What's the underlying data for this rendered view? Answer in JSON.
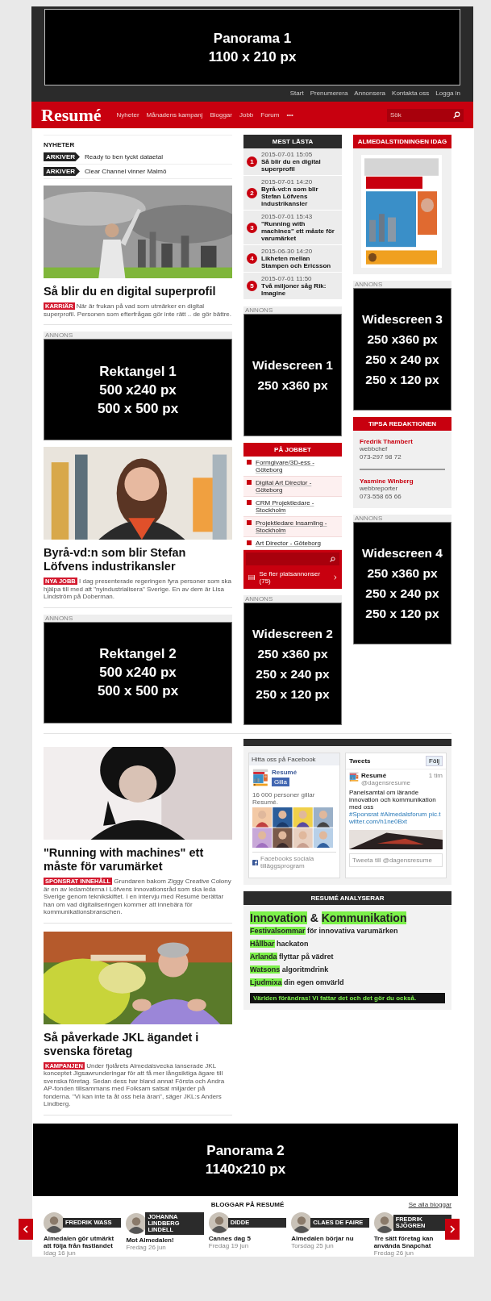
{
  "panorama_top": {
    "lines": [
      "Panorama 1",
      "1100 x 210 px"
    ]
  },
  "top_links": [
    "Start",
    "Prenumerera",
    "Annonsera",
    "Kontakta oss",
    "Logga in"
  ],
  "logo": "Resumé",
  "nav": [
    "Nyheter",
    "Månadens kampanj",
    "Bloggar",
    "Jobb",
    "Forum",
    "•••"
  ],
  "search": {
    "placeholder": "Sök"
  },
  "news_ticker": {
    "heading": "NYHETER",
    "items": [
      {
        "tag": "ARKIVER",
        "text": "Ready to ben tyckt dataetal"
      },
      {
        "tag": "ARKIVER",
        "text": "Clear Channel vinner Malmö"
      }
    ]
  },
  "feed": [
    {
      "kind": "article",
      "headline": "Så blir du en digital superprofil",
      "tag": "KARRIÄR",
      "text": "När är frukan på vad som utmärker en digital superprofil. Personen som efterfrågas gör inte rätt .. de gör bättre."
    },
    {
      "kind": "ad",
      "label": "ANNONS",
      "lines": [
        "Rektangel 1",
        "500 x240 px",
        "500 x 500 px"
      ]
    },
    {
      "kind": "article",
      "headline": "Byrå-vd:n som blir Stefan Löfvens industrikansler",
      "tag": "NYA JOBB",
      "text": "I dag presenterade regeringen fyra personer som ska hjälpa till med att \"nyindustrialisera\" Sverige. En av dem är Lisa Lindström på Doberman."
    },
    {
      "kind": "ad",
      "label": "ANNONS",
      "lines": [
        "Rektangel 2",
        "500 x240 px",
        "500 x 500 px"
      ]
    }
  ],
  "most_read": {
    "heading": "MEST LÄSTA",
    "items": [
      {
        "number": "1",
        "time": "2015-07-01 15:05",
        "title": "Så blir du en digital superprofil"
      },
      {
        "number": "2",
        "time": "2015-07-01 14:20",
        "title": "Byrå-vd:n som blir Stefan Löfvens industrikansler"
      },
      {
        "number": "3",
        "time": "2015-07-01 15:43",
        "title": "\"Running with machines\" ett måste för varumärket"
      },
      {
        "number": "4",
        "time": "2015-06-30 14:20",
        "title": "Likheten mellan Stampen och Ericsson"
      },
      {
        "number": "5",
        "time": "2015-07-01 11:50",
        "title": "Två miljoner såg Rik: Imagine"
      }
    ]
  },
  "widescreen_1": {
    "label": "ANNONS",
    "lines": [
      "Widescreen 1",
      "250 x360 px"
    ]
  },
  "jobs": {
    "heading": "PÅ JOBBET",
    "items": [
      "Formgivare/3D-ess - Göteborg",
      "Digital Art Director - Göteborg",
      "CRM Projektledare - Stockholm",
      "Projektledare Insamling - Stockholm",
      "Art Director - Göteborg"
    ],
    "footer": "Se fler platsannonser (75)"
  },
  "widescreen_2": {
    "label": "ANNONS",
    "lines": [
      "Widescreen 2",
      "250 x360 px",
      "250 x 240 px",
      "250 x 120 px"
    ]
  },
  "magazine": {
    "heading": "ALMEDALSTIDNINGEN IDAG"
  },
  "widescreen_3": {
    "label": "ANNONS",
    "lines": [
      "Widescreen 3",
      "250 x360 px",
      "250 x 240 px",
      "250 x 120 px"
    ]
  },
  "tips": {
    "heading": "TIPSA REDAKTIONEN",
    "contacts": [
      {
        "name": "Fredrik Thambert",
        "role": "webbchef",
        "phone": "073-297 98 72"
      },
      {
        "name": "Yasmine Winberg",
        "role": "webbreporter",
        "phone": "073-558 65 66"
      }
    ]
  },
  "widescreen_4": {
    "label": "ANNONS",
    "lines": [
      "Widescreen 4",
      "250 x360 px",
      "250 x 240 px",
      "250 x 120 px"
    ]
  },
  "feed_lower": [
    {
      "kind": "article",
      "headline": "\"Running with machines\" ett måste för varumärket",
      "tag": "SPONSRAT INNEHÅLL",
      "text": "Grundaren bakom Ziggy Creative Colony är en av ledamöterna i Löfvens innovationsråd som ska leda Sverige genom teknikskiftet. I en intervju med Resumé berättar han om vad digitaliseringen kommer att innebära för kommunikationsbranschen."
    },
    {
      "kind": "article",
      "headline": "Så påverkade JKL ägandet i svenska företag",
      "tag": "KAMPANJEN",
      "text": "Under fjolårets Almedalsvecka lanserade JKL konceptet Jigsawrunderingar för att få mer långsiktiga ägare till svenska företag. Sedan dess har bland annat Första och Andra AP-fonden tillsammans med Folksam satsat miljarder på fonderna. \"Vi kan inte ta åt oss hela äran\", säger JKL:s Anders Lindberg."
    }
  ],
  "facebook": {
    "heading": "Hitta oss på Facebook",
    "page": "Resumé",
    "like": "Gilla",
    "count": "16 000 personer gillar Resumé.",
    "footer": "Facebooks sociala tilläggsprogram"
  },
  "twitter": {
    "heading": "Tweets",
    "follow": "Följ",
    "author": "Resumé",
    "handle": "@dagensresume",
    "age": "1 tim",
    "text": "Panelsamtal om lärande innovation och kommunikation med oss",
    "link": "#Sponsrat #Almedalsforum pic.twitter.com/h1ne0Bxt",
    "compose": "Tweeta till @dagensresume"
  },
  "analysis": {
    "heading": "RESUMÉ ANALYSERAR",
    "title": [
      {
        "text": "Innovation",
        "highlight": true
      },
      {
        "text": "&",
        "highlight": false
      },
      {
        "text": "Kommunikation",
        "highlight": true
      }
    ],
    "lines": [
      {
        "highlight": "Festivalsommar",
        "rest": "för innovativa varumärken"
      },
      {
        "highlight": "Hållbar",
        "rest": "hackaton"
      },
      {
        "highlight": "Arlanda",
        "rest": "flyttar på vädret"
      },
      {
        "highlight": "Watsons",
        "rest": "algoritmdrink"
      },
      {
        "highlight": "Ljudmixa",
        "rest": "din egen omvärld"
      }
    ],
    "footer": "Världen förändras! Vi fattar det och det gör du också."
  },
  "panorama_bottom": {
    "lines": [
      "Panorama 2",
      "1140x210 px"
    ]
  },
  "blogs": {
    "heading": "BLOGGAR PÅ RESUMÉ",
    "see_all": "Se alla bloggar",
    "items": [
      {
        "name": "FREDRIK WASS",
        "title": "Almedalen gör utmärkt att följa från fastlandet",
        "date": "Idag 16 jun"
      },
      {
        "name": "JOHANNA LINDBERG LINDELL",
        "title": "Mot Almedalen!",
        "date": "Fredag 26 jun"
      },
      {
        "name": "DIDDE",
        "title": "Cannes dag 5",
        "date": "Fredag 19 jun"
      },
      {
        "name": "CLAES DE FAIRE",
        "title": "Almedalen börjar nu",
        "date": "Torsdag 25 jun"
      },
      {
        "name": "FREDRIK SJÖGREN",
        "title": "Tre sätt företag kan använda Snapchat",
        "date": "Fredag 26 jun"
      }
    ]
  }
}
